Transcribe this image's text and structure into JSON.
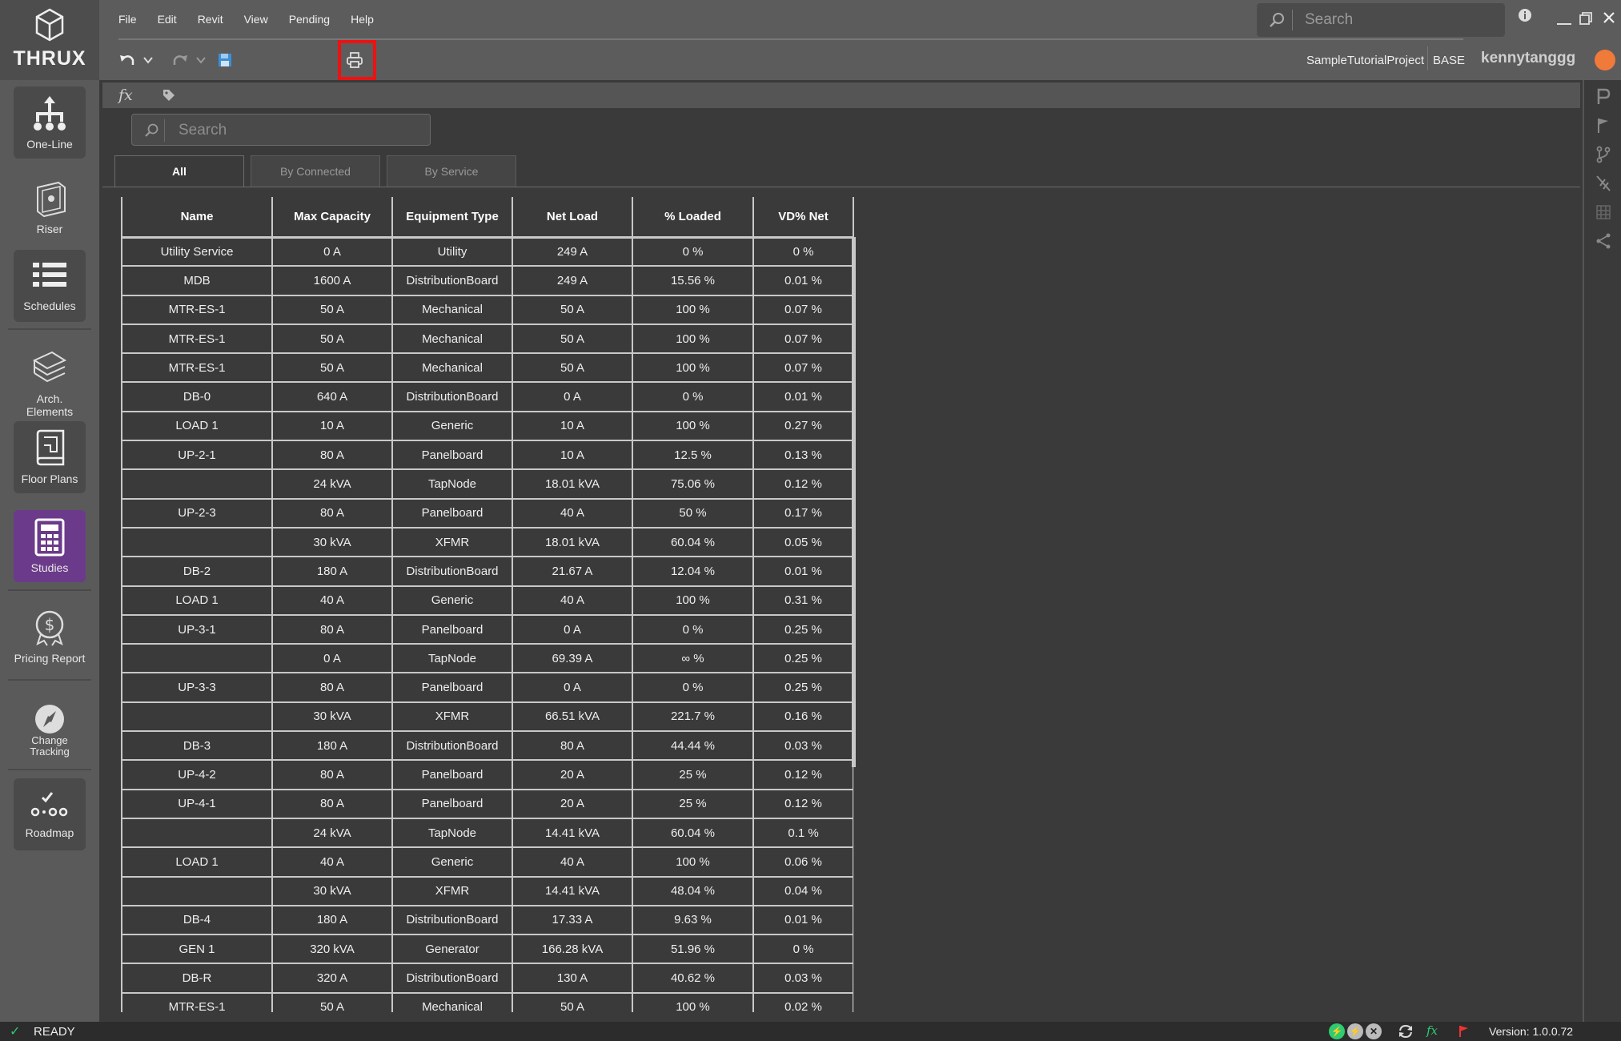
{
  "app": {
    "name": "THRUX"
  },
  "sidebar": {
    "items": [
      {
        "label": "One-Line",
        "icon": "one-line-icon"
      },
      {
        "label": "Riser",
        "icon": "riser-icon"
      },
      {
        "label": "Schedules",
        "icon": "schedules-icon"
      },
      {
        "label": "Arch. Elements",
        "icon": "arch-elements-icon"
      },
      {
        "label": "Floor Plans",
        "icon": "floor-plans-icon"
      },
      {
        "label": "Studies",
        "icon": "studies-icon"
      },
      {
        "label": "Pricing Report",
        "icon": "pricing-report-icon"
      },
      {
        "label": "Change Tracking",
        "icon": "change-tracking-icon"
      },
      {
        "label": "Roadmap",
        "icon": "roadmap-icon"
      }
    ],
    "active": "Studies"
  },
  "menu": [
    "File",
    "Edit",
    "Revit",
    "View",
    "Pending",
    "Help"
  ],
  "top_search": {
    "placeholder": "Search"
  },
  "project": {
    "name": "SampleTutorialProject",
    "branch": "BASE",
    "user": "kennytanggg"
  },
  "content_search": {
    "placeholder": "Search"
  },
  "tabs": [
    {
      "label": "All",
      "active": true
    },
    {
      "label": "By Connected",
      "active": false
    },
    {
      "label": "By Service",
      "active": false
    }
  ],
  "table": {
    "columns": [
      "Name",
      "Max Capacity",
      "Equipment Type",
      "Net Load",
      "% Loaded",
      "VD% Net"
    ],
    "rows": [
      [
        "Utility Service",
        "0 A",
        "Utility",
        "249 A",
        "0 %",
        "0 %"
      ],
      [
        "MDB",
        "1600 A",
        "DistributionBoard",
        "249 A",
        "15.56 %",
        "0.01 %"
      ],
      [
        "MTR-ES-1",
        "50 A",
        "Mechanical",
        "50 A",
        "100 %",
        "0.07 %"
      ],
      [
        "MTR-ES-1",
        "50 A",
        "Mechanical",
        "50 A",
        "100 %",
        "0.07 %"
      ],
      [
        "MTR-ES-1",
        "50 A",
        "Mechanical",
        "50 A",
        "100 %",
        "0.07 %"
      ],
      [
        "DB-0",
        "640 A",
        "DistributionBoard",
        "0 A",
        "0 %",
        "0.01 %"
      ],
      [
        "LOAD 1",
        "10 A",
        "Generic",
        "10 A",
        "100 %",
        "0.27 %"
      ],
      [
        "UP-2-1",
        "80 A",
        "Panelboard",
        "10 A",
        "12.5 %",
        "0.13 %"
      ],
      [
        "",
        "24 kVA",
        "TapNode",
        "18.01 kVA",
        "75.06 %",
        "0.12 %"
      ],
      [
        "UP-2-3",
        "80 A",
        "Panelboard",
        "40 A",
        "50 %",
        "0.17 %"
      ],
      [
        "",
        "30 kVA",
        "XFMR",
        "18.01 kVA",
        "60.04 %",
        "0.05 %"
      ],
      [
        "DB-2",
        "180 A",
        "DistributionBoard",
        "21.67 A",
        "12.04 %",
        "0.01 %"
      ],
      [
        "LOAD 1",
        "40 A",
        "Generic",
        "40 A",
        "100 %",
        "0.31 %"
      ],
      [
        "UP-3-1",
        "80 A",
        "Panelboard",
        "0 A",
        "0 %",
        "0.25 %"
      ],
      [
        "",
        "0 A",
        "TapNode",
        "69.39 A",
        "∞ %",
        "0.25 %"
      ],
      [
        "UP-3-3",
        "80 A",
        "Panelboard",
        "0 A",
        "0 %",
        "0.25 %"
      ],
      [
        "",
        "30 kVA",
        "XFMR",
        "66.51 kVA",
        "221.7 %",
        "0.16 %"
      ],
      [
        "DB-3",
        "180 A",
        "DistributionBoard",
        "80 A",
        "44.44 %",
        "0.03 %"
      ],
      [
        "UP-4-2",
        "80 A",
        "Panelboard",
        "20 A",
        "25 %",
        "0.12 %"
      ],
      [
        "UP-4-1",
        "80 A",
        "Panelboard",
        "20 A",
        "25 %",
        "0.12 %"
      ],
      [
        "",
        "24 kVA",
        "TapNode",
        "14.41 kVA",
        "60.04 %",
        "0.1 %"
      ],
      [
        "LOAD 1",
        "40 A",
        "Generic",
        "40 A",
        "100 %",
        "0.06 %"
      ],
      [
        "",
        "30 kVA",
        "XFMR",
        "14.41 kVA",
        "48.04 %",
        "0.04 %"
      ],
      [
        "DB-4",
        "180 A",
        "DistributionBoard",
        "17.33 A",
        "9.63 %",
        "0.01 %"
      ],
      [
        "GEN 1",
        "320 kVA",
        "Generator",
        "166.28 kVA",
        "51.96 %",
        "0 %"
      ],
      [
        "DB-R",
        "320 A",
        "DistributionBoard",
        "130 A",
        "40.62 %",
        "0.03 %"
      ],
      [
        "MTR-ES-1",
        "50 A",
        "Mechanical",
        "50 A",
        "100 %",
        "0.02 %"
      ]
    ]
  },
  "status": {
    "text": "READY",
    "version": "Version: 1.0.0.72"
  },
  "colors": {
    "accent": "#6b3a8a",
    "highlight": "#ee1111",
    "ok": "#2ecc71"
  }
}
